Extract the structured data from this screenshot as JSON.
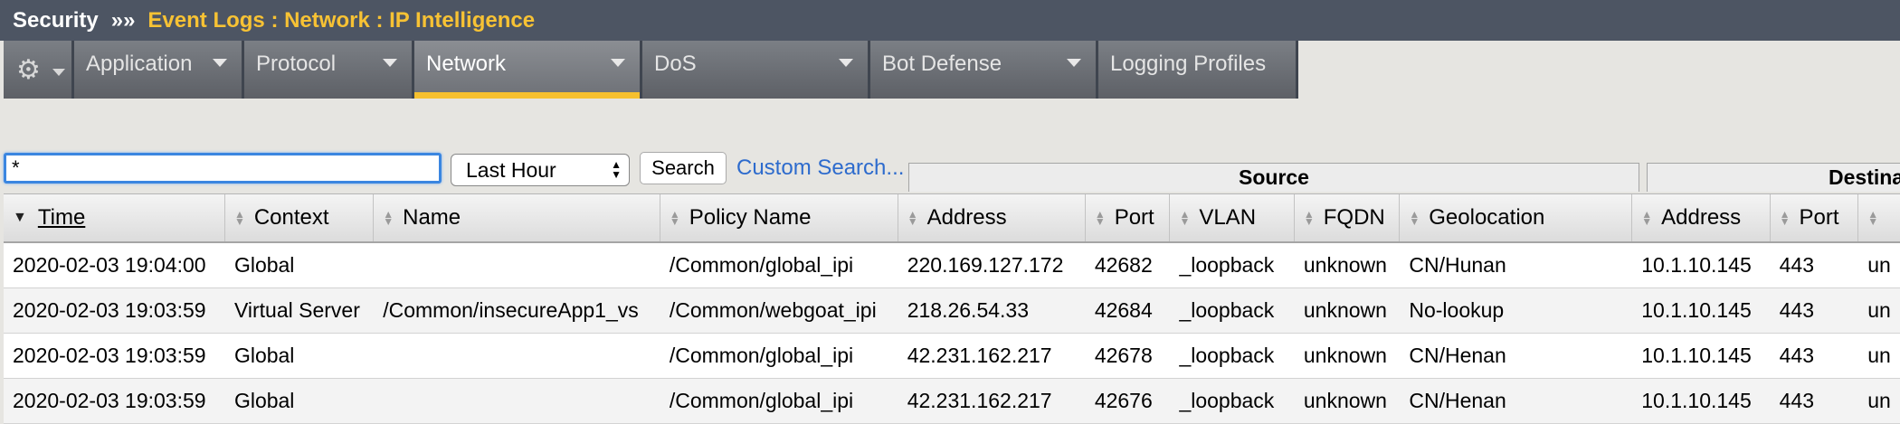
{
  "header": {
    "section": "Security",
    "separator": "»»",
    "breadcrumb": "Event Logs : Network : IP Intelligence"
  },
  "tabs": [
    {
      "label": "Application",
      "has_caret": true,
      "active": false
    },
    {
      "label": "Protocol",
      "has_caret": true,
      "active": false
    },
    {
      "label": "Network",
      "has_caret": true,
      "active": true
    },
    {
      "label": "DoS",
      "has_caret": true,
      "active": false
    },
    {
      "label": "Bot Defense",
      "has_caret": true,
      "active": false
    },
    {
      "label": "Logging Profiles",
      "has_caret": false,
      "active": false
    }
  ],
  "toolbar": {
    "search_value": "*",
    "time_range": "Last Hour",
    "search_button": "Search",
    "custom_search": "Custom Search..."
  },
  "groups": {
    "source": "Source",
    "destination": "Destina"
  },
  "columns": [
    "Time",
    "Context",
    "Name",
    "Policy Name",
    "Address",
    "Port",
    "VLAN",
    "FQDN",
    "Geolocation",
    "Address",
    "Port",
    ""
  ],
  "rows": [
    [
      "2020-02-03 19:04:00",
      "Global",
      "",
      "/Common/global_ipi",
      "220.169.127.172",
      "42682",
      "_loopback",
      "unknown",
      "CN/Hunan",
      "10.1.10.145",
      "443",
      "un"
    ],
    [
      "2020-02-03 19:03:59",
      "Virtual Server",
      "/Common/insecureApp1_vs",
      "/Common/webgoat_ipi",
      "218.26.54.33",
      "42684",
      "_loopback",
      "unknown",
      "No-lookup",
      "10.1.10.145",
      "443",
      "un"
    ],
    [
      "2020-02-03 19:03:59",
      "Global",
      "",
      "/Common/global_ipi",
      "42.231.162.217",
      "42678",
      "_loopback",
      "unknown",
      "CN/Henan",
      "10.1.10.145",
      "443",
      "un"
    ],
    [
      "2020-02-03 19:03:59",
      "Global",
      "",
      "/Common/global_ipi",
      "42.231.162.217",
      "42676",
      "_loopback",
      "unknown",
      "CN/Henan",
      "10.1.10.145",
      "443",
      "un"
    ]
  ],
  "colors": {
    "header_bg": "#4d5563",
    "breadcrumb": "#f7c234",
    "active_tab_underline": "#f6c02f",
    "link": "#2d6bcd"
  }
}
